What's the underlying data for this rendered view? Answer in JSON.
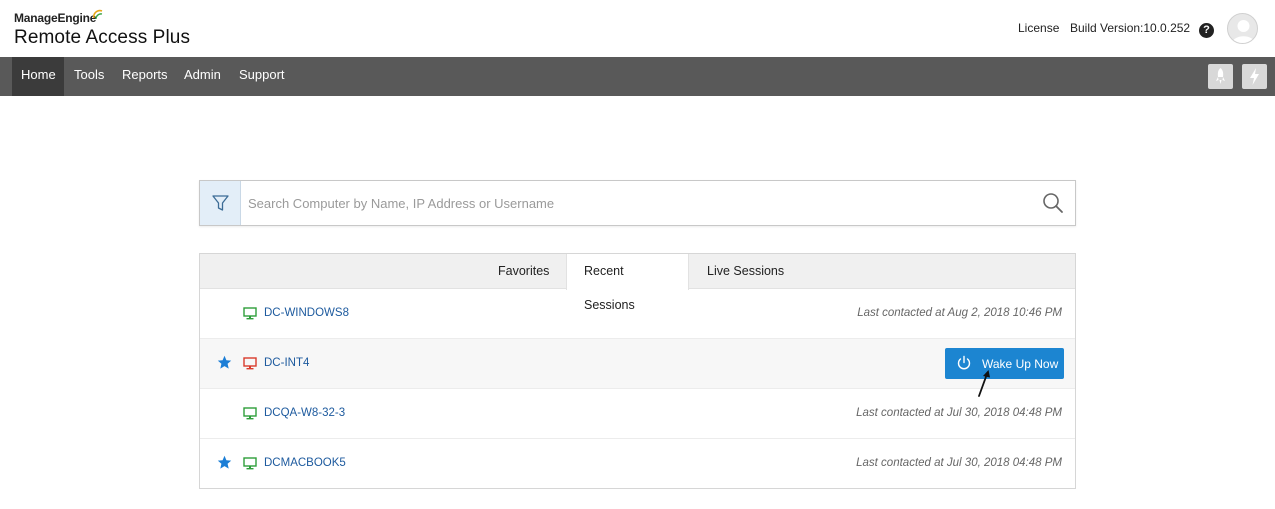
{
  "brand": {
    "top": "ManageEngine",
    "product": "Remote Access Plus"
  },
  "header": {
    "license": "License",
    "build": "Build Version:10.0.252",
    "help": "?"
  },
  "nav": {
    "items": [
      "Home",
      "Tools",
      "Reports",
      "Admin",
      "Support"
    ],
    "active": "Home"
  },
  "search": {
    "placeholder": "Search Computer by Name, IP Address or Username",
    "value": ""
  },
  "tabs": {
    "items": [
      "Favorites",
      "Recent Sessions",
      "Live Sessions"
    ],
    "active": "Recent Sessions"
  },
  "sessions": [
    {
      "name": "DC-WINDOWS8",
      "favorite": false,
      "status": "online",
      "last_contacted": "Last contacted at Aug 2, 2018 10:46 PM"
    },
    {
      "name": "DC-INT4",
      "favorite": true,
      "status": "offline",
      "action": "Wake Up Now"
    },
    {
      "name": "DCQA-W8-32-3",
      "favorite": false,
      "status": "online",
      "last_contacted": "Last contacted at Jul 30, 2018 04:48 PM"
    },
    {
      "name": "DCMACBOOK5",
      "favorite": true,
      "status": "online",
      "last_contacted": "Last contacted at Jul 30, 2018 04:48 PM"
    }
  ],
  "colors": {
    "accent": "#1c85d1",
    "nav_bg": "#595959",
    "online": "#2e9e3a",
    "offline": "#d93b2b",
    "star": "#1c7ed6"
  }
}
